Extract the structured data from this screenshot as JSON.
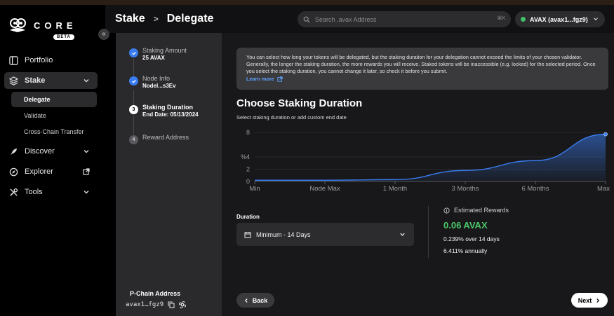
{
  "app": {
    "logo_text": "CORE",
    "badge": "BETA"
  },
  "nav": {
    "items": [
      {
        "label": "Portfolio",
        "icon": "portfolio-icon"
      },
      {
        "label": "Stake",
        "icon": "stack-icon",
        "active": true,
        "sub": [
          {
            "label": "Delegate",
            "active": true
          },
          {
            "label": "Validate"
          },
          {
            "label": "Cross-Chain Transfer"
          }
        ]
      },
      {
        "label": "Discover",
        "icon": "rocket-icon"
      },
      {
        "label": "Explorer",
        "icon": "compass-icon"
      },
      {
        "label": "Tools",
        "icon": "tools-icon"
      }
    ]
  },
  "header": {
    "breadcrumb": [
      "Stake",
      "Delegate"
    ],
    "search_placeholder": "Search .avax Address",
    "search_shortcut": "⌘K",
    "wallet_label": "AVAX (avax1...fgz9)",
    "wallet_status_color": "#42c16a"
  },
  "steps": [
    {
      "num": "1",
      "title": "Staking Amount",
      "value": "25 AVAX",
      "state": "done"
    },
    {
      "num": "2",
      "title": "Node Info",
      "value": "NodeI...s3Ev",
      "state": "done"
    },
    {
      "num": "3",
      "title": "Staking Duration",
      "value": "End Date: 05/13/2024",
      "state": "current"
    },
    {
      "num": "4",
      "title": "Reward Address",
      "value": "",
      "state": "todo"
    }
  ],
  "pchain": {
    "label": "P-Chain Address",
    "value": "avax1…fgz9"
  },
  "main": {
    "info_text": "You can select how long your tokens will be delegated, but the staking duration for your delegation cannot exceed the limits of your chosen validator. Generally, the longer the staking duration, the more rewards you will receive. Staked tokens will be inaccessible (e.g. locked) for the selected period. Once you select the staking duration, you cannot change it later, so check it before you submit.",
    "learn_more": "Learn more",
    "title": "Choose Staking Duration",
    "subtitle": "Select staking duration or add custom end date",
    "duration_label": "Duration",
    "duration_value": "Minimum - 14 Days",
    "estimated_label": "Estimated Rewards",
    "reward_amount": "0.06 AVAX",
    "reward_period": "0.239% over 14 days",
    "reward_annual": "6.411% annually",
    "back_label": "Back",
    "next_label": "Next",
    "accent_color": "#3a7df0",
    "reward_color": "#4cc86a"
  },
  "chart_data": {
    "type": "area",
    "x": [
      "Min",
      "Node Max",
      "1 Month",
      "3 Months",
      "6 Months",
      "Max"
    ],
    "y_ticks": [
      "8",
      "4",
      "2",
      "0"
    ],
    "ylabel": "%",
    "ylim": [
      0,
      8
    ],
    "values": [
      0.2,
      0.2,
      0.3,
      1.8,
      3.4,
      7.7
    ]
  }
}
